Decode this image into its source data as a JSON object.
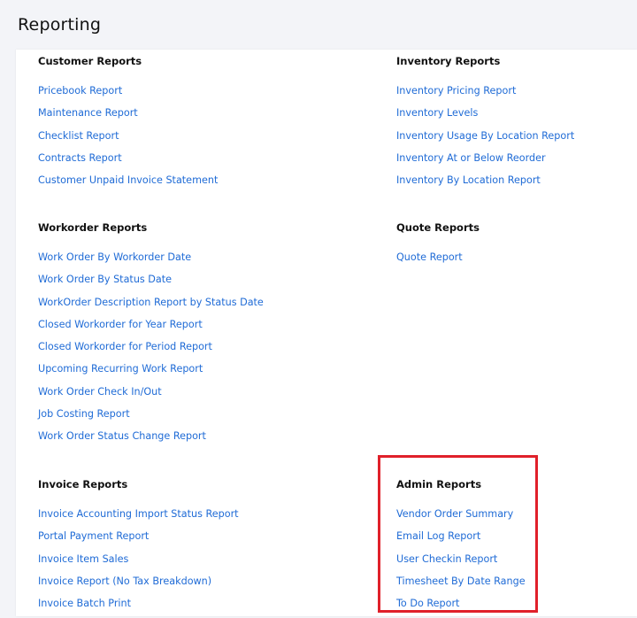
{
  "page": {
    "title": "Reporting",
    "link_color": "#1f6bd6",
    "highlight_color": "#e0202a"
  },
  "sections": {
    "customer": {
      "title": "Customer Reports",
      "links": [
        "Pricebook Report",
        "Maintenance Report",
        "Checklist Report",
        "Contracts Report",
        "Customer Unpaid Invoice Statement"
      ]
    },
    "inventory": {
      "title": "Inventory Reports",
      "links": [
        "Inventory Pricing Report",
        "Inventory Levels",
        "Inventory Usage By Location Report",
        "Inventory At or Below Reorder",
        "Inventory By Location Report"
      ]
    },
    "workorder": {
      "title": "Workorder Reports",
      "links": [
        "Work Order By Workorder Date",
        "Work Order By Status Date",
        "WorkOrder Description Report by Status Date",
        "Closed Workorder for Year Report",
        "Closed Workorder for Period Report",
        "Upcoming Recurring Work Report",
        "Work Order Check In/Out",
        "Job Costing Report",
        "Work Order Status Change Report"
      ]
    },
    "quote": {
      "title": "Quote Reports",
      "links": [
        "Quote Report"
      ]
    },
    "invoice": {
      "title": "Invoice Reports",
      "links": [
        "Invoice Accounting Import Status Report",
        "Portal Payment Report",
        "Invoice Item Sales",
        "Invoice Report (No Tax Breakdown)",
        "Invoice Batch Print"
      ]
    },
    "admin": {
      "title": "Admin Reports",
      "links": [
        "Vendor Order Summary",
        "Email Log Report",
        "User Checkin Report",
        "Timesheet By Date Range",
        "To Do Report"
      ]
    }
  }
}
